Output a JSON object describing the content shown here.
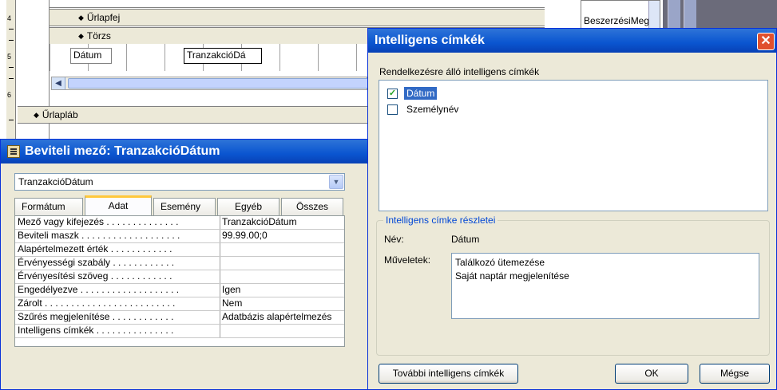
{
  "design": {
    "ruler_numbers": [
      "4",
      "5",
      "6"
    ],
    "header_section": "Űrlapfej",
    "detail_section": "Törzs",
    "footer_section": "Űrlapláb",
    "label_datum": "Dátum",
    "textbox_tranzakcio": "TranzakcióDá",
    "fieldlist_item": "BeszerzésiMeg"
  },
  "props": {
    "title": "Beviteli mező: TranzakcióDátum",
    "selected_object": "TranzakcióDátum",
    "tabs": [
      "Formátum",
      "Adat",
      "Esemény",
      "Egyéb",
      "Összes"
    ],
    "active_tab": "Adat",
    "rows": [
      {
        "name": "Mező vagy kifejezés . . . . . . . . . . . . . .",
        "value": "TranzakcióDátum"
      },
      {
        "name": "Beviteli maszk . . . . . . . . . . . . . . . . . . .",
        "value": "99.99.00;0"
      },
      {
        "name": "Alapértelmezett érték . . . . . . . . . . . .",
        "value": ""
      },
      {
        "name": "Érvényességi szabály . . . . . . . . . . . .",
        "value": ""
      },
      {
        "name": "Érvényesítési szöveg . . . . . . . . . . . .",
        "value": ""
      },
      {
        "name": "Engedélyezve . . . . . . . . . . . . . . . . . . .",
        "value": "Igen"
      },
      {
        "name": "Zárolt . . . . . . . . . . . . . . . . . . . . . . . . .",
        "value": "Nem"
      },
      {
        "name": "Szűrés megjelenítése . . . . . . . . . . . .",
        "value": "Adatbázis alapértelmezés"
      },
      {
        "name": "Intelligens címkék . . . . . . . . . . . . . . .",
        "value": ""
      }
    ]
  },
  "dialog": {
    "title": "Intelligens címkék",
    "available_label": "Rendelkezésre álló intelligens címkék",
    "tags": [
      {
        "label": "Dátum",
        "checked": true,
        "selected": true
      },
      {
        "label": "Személynév",
        "checked": false,
        "selected": false
      }
    ],
    "details_legend": "Intelligens címke részletei",
    "name_label": "Név:",
    "name_value": "Dátum",
    "actions_label": "Műveletek:",
    "actions": [
      "Találkozó ütemezése",
      "Saját naptár megjelenítése"
    ],
    "more_button": "További intelligens címkék",
    "ok_button": "OK",
    "cancel_button": "Mégse"
  }
}
